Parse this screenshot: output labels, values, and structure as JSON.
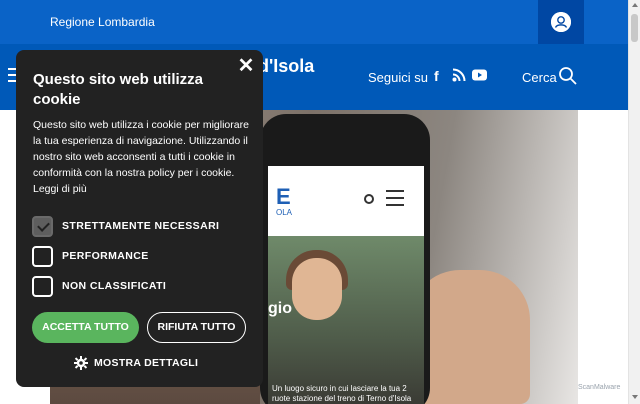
{
  "topbar": {
    "region_link": "Regione Lombardia"
  },
  "header": {
    "site_title_visible": "d'Isola",
    "follow_label": "Seguici su",
    "search_label": "Cerca"
  },
  "hero": {
    "screen_logo": "E",
    "screen_logo_sub": "OLA",
    "screen_word": "gio",
    "screen_caption": "Un luogo sicuro in cui lasciare la tua 2 ruote\nstazione del treno di Terno d'Isola"
  },
  "cookie": {
    "title": "Questo sito web utilizza cookie",
    "body": "Questo sito web utilizza i cookie per migliorare la tua esperienza di navigazione. Utilizzando il nostro sito web acconsenti a tutti i cookie in conformità con la nostra policy per i cookie. Leggi di più",
    "close_symbol": "✕",
    "options": [
      {
        "label": "STRETTAMENTE NECESSARI",
        "checked": true
      },
      {
        "label": "PERFORMANCE",
        "checked": false
      },
      {
        "label": "NON CLASSIFICATI",
        "checked": false
      }
    ],
    "accept_label": "ACCETTA TUTTO",
    "reject_label": "RIFIUTA TUTTO",
    "details_label": "MOSTRA DETTAGLI"
  },
  "watermark": "ScanMalware",
  "colors": {
    "topbar": "#0a63c7",
    "header": "#0059b8",
    "modal": "#222222",
    "accept": "#5ab55e"
  },
  "icons": [
    "user-icon",
    "menu-icon",
    "facebook-icon",
    "rss-icon",
    "youtube-icon",
    "search-icon",
    "close-icon",
    "gear-icon"
  ]
}
